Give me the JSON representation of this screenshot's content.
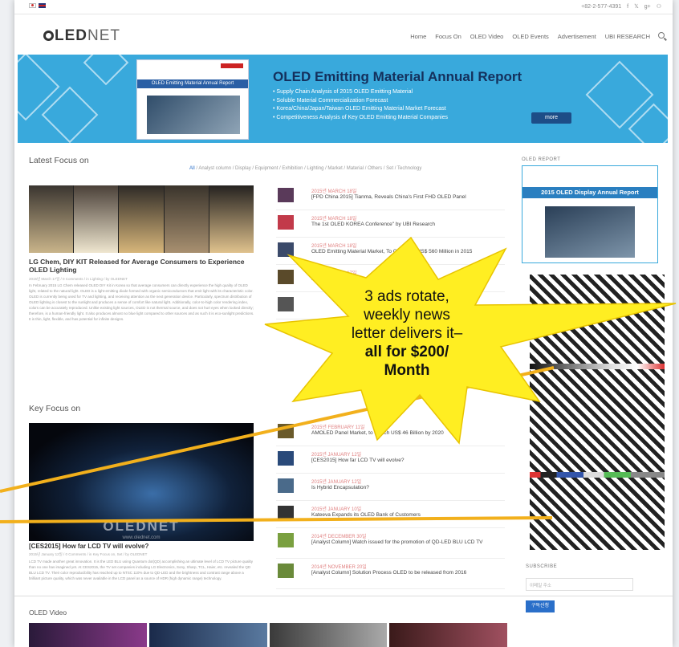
{
  "topbar": {
    "phone": "+82-2-577-4391",
    "social": [
      "f",
      "𝕏",
      "g+",
      "⚇"
    ]
  },
  "logo": {
    "oled": "LED",
    "net": "NET"
  },
  "nav": [
    "Home",
    "Focus On",
    "OLED Video",
    "OLED Events",
    "Advertisement",
    "UBI RESEARCH"
  ],
  "banner": {
    "title": "OLED Emitting Material Annual Report",
    "cover_label": "OLED Emitting Material Annual Report",
    "bullets": [
      "Supply Chain Analysis of 2015 OLED Emitting Material",
      "Soluble Material Commercialization Forecast",
      "Korea/China/Japan/Taiwan OLED Emitting Material Market Forecast",
      "Competitiveness Analysis of Key OLED Emitting Material Companies"
    ],
    "more": "more"
  },
  "latest": {
    "title": "Latest Focus on",
    "cats_all": "All",
    "cats": " / Analyst column / Display / Equipment / Exhibition / Lighting / Market / Material / Others / Set / Technology",
    "headline": "LG Chem, DIY KIT Released for Average Consumers to Experience OLED Lighting",
    "meta": "2015년 March 17일 / 0 Comments / in Lighting / by OLEDNET",
    "body": "In February 2015 LG Chem released OLED DIY Kit in Korea so that average consumers can directly experience the high quality of OLED light, related to the natural light. OLED is a light-emitting diode formed with organic semiconductors that emit light with its characteristic color. OLED is currently being used for TV and lighting, and receiving attention as the next generation device. Particularly, spectrum distribution of OLED lighting is closest to the sunlight and produces a sense of comfort like natural light. Additionally, color-to-high color rendering index, colors can be accurately reproduced. Unlike existing light sources, OLED is not thermal source, and does not hurt eyes when looked directly; therefore, is a human-friendly light. It also produces almost no blue light compared to other sources and as such it is eco-sunlight predictions. It is thin, light, flexible, and has potential for infinite designs.",
    "items": [
      {
        "date": "2015년 MARCH 18일",
        "title": "[FPD China 2015] Tianma, Reveals China's First FHD OLED Panel"
      },
      {
        "date": "2015년 MARCH 18일",
        "title": "The 1st OLED KOREA Conference\" by UBI Research"
      },
      {
        "date": "2015년 MARCH 18일",
        "title": "OLED Emitting Material Market, To Grow Into US$ 560 Million in 2015"
      },
      {
        "date": "2015년 MARCH 17일",
        "title": "LG Chem, DIY KIT Released for Average"
      },
      {
        "date": "",
        "title": ""
      }
    ]
  },
  "key": {
    "title": "Key Focus on",
    "watermark": "OLEDNET",
    "url": "www.olednet.com",
    "headline": "[CES2015] How far LCD TV will evolve?",
    "meta": "2015년 January 12일 / 0 Comments / in Key Focus on, Set / by OLEDNET",
    "body": "LCD TV made another great innovation. It is the LED BLU using Quantum dot(QD) accomplishing an ultimate level of LCD TV picture quality than no one has imagined yet. At CES2015, the TV set companies including LG Electronics, Sony, Sharp, TCL, Haier, etc. revealed the QD BLU LCD TV. Their color reproducibility has reached up to NTSC 110% due to QD-LED and the brightness and contrast range above a brilliant picture quality, which was never available in the LCD panel as a source of HDR (high dynamic range) technology.",
    "items": [
      {
        "date": "2015년 FEBRUARY 11일",
        "title": "AMOLED Panel Market, to Reach US$ 46 Billion by 2020"
      },
      {
        "date": "2015년 JANUARY 12일",
        "title": "[CES2015] How far LCD TV will evolve?"
      },
      {
        "date": "2015년 JANUARY 12일",
        "title": "Is Hybrid Encapsulation?"
      },
      {
        "date": "2015년 JANUARY 10일",
        "title": "Kateeva Expands its OLED Bank of Customers"
      },
      {
        "date": "2014년 DECEMBER 30일",
        "title": "[Analyst Column] Watch issued for the promotion of QD-LED BLU LCD TV"
      },
      {
        "date": "2014년 NOVEMBER 20일",
        "title": "[Analyst Column] Solution Process OLED to be released from 2016"
      }
    ]
  },
  "sidebar": {
    "report_label": "OLED REPORT",
    "report_title": "2015 OLED Display Annual Report",
    "subscribe": "SUBSCRIBE",
    "email_placeholder": "이메일 주소",
    "subscribe_btn": "구독신청"
  },
  "video": {
    "title": "OLED Video"
  },
  "callout": {
    "line1": "3 ads rotate,",
    "line2": "weekly news",
    "line3": "letter delivers it–",
    "line4": "all for $200/",
    "line5": "Month"
  },
  "colors": {
    "banner": "#39a9dc",
    "star": "#ffee22",
    "arrow": "#f2b01c",
    "accent": "#2a6fc9"
  }
}
